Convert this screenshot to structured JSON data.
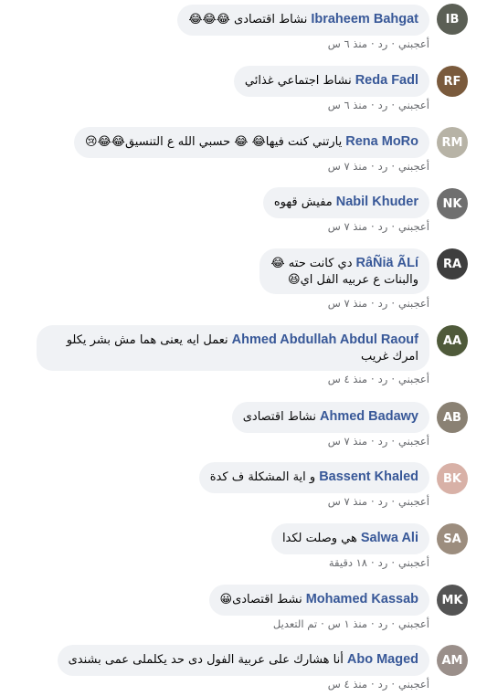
{
  "actions": {
    "like": "أعجبني",
    "reply": "رد",
    "sep": "·"
  },
  "comments": [
    {
      "author": "Ibraheem Bahgat",
      "text": "نشاط اقتصادى 😂😂😂",
      "time": "منذ ٦ س",
      "edited": "",
      "avatar": "IB",
      "avatar_color": "#5b5f55"
    },
    {
      "author": "Reda Fadl",
      "text": "نشاط اجتماعي غذائي",
      "time": "منذ ٦ س",
      "edited": "",
      "avatar": "RF",
      "avatar_color": "#7a5a3c"
    },
    {
      "author": "Rena MoRo",
      "text": "يارتني كنت فيها😂 😂 حسبي الله ع التنسيق😂😂😢",
      "time": "منذ ٧ س",
      "edited": "",
      "avatar": "RM",
      "avatar_color": "#b7b3a6"
    },
    {
      "author": "Nabil Khuder",
      "text": "مفيش قهوه",
      "time": "منذ ٧ س",
      "edited": "",
      "avatar": "NK",
      "avatar_color": "#6f6f6f"
    },
    {
      "author": "RâÑiä ÃLí",
      "text": "دي كانت حته 😂",
      "text2": "والبنات ع عربيه الفل اي😆",
      "time": "منذ ٧ س",
      "edited": "",
      "avatar": "RA",
      "avatar_color": "#3e3e3e"
    },
    {
      "author": "Ahmed Abdullah Abdul Raouf",
      "text": "نعمل ايه يعنى هما مش بشر يكلو",
      "text2": "امرك غريب",
      "time": "منذ ٤ س",
      "edited": "",
      "avatar": "AA",
      "avatar_color": "#4f5a3a"
    },
    {
      "author": "Ahmed Badawy",
      "text": "نشاط اقتصادى",
      "time": "منذ ٧ س",
      "edited": "",
      "avatar": "AB",
      "avatar_color": "#8a8173"
    },
    {
      "author": "Bassent Khaled",
      "text": "و اية المشكلة ف كدة",
      "time": "منذ ٧ س",
      "edited": "",
      "avatar": "BK",
      "avatar_color": "#d8b1a7"
    },
    {
      "author": "Salwa Ali",
      "text": "هي وصلت لكدا",
      "time": "١٨ دقيقة",
      "edited": "",
      "avatar": "SA",
      "avatar_color": "#9c8d7e"
    },
    {
      "author": "Mohamed Kassab",
      "text": "نشط اقتصادى😀",
      "time": "منذ ١ س",
      "edited": "تم التعديل",
      "avatar": "MK",
      "avatar_color": "#545454"
    },
    {
      "author": "Abo Maged",
      "text": "أنا هشارك على عربية الفول دى حد يكلملى عمى بشندى",
      "time": "منذ ٤ س",
      "edited": "",
      "avatar": "AM",
      "avatar_color": "#9a8f8a"
    }
  ]
}
